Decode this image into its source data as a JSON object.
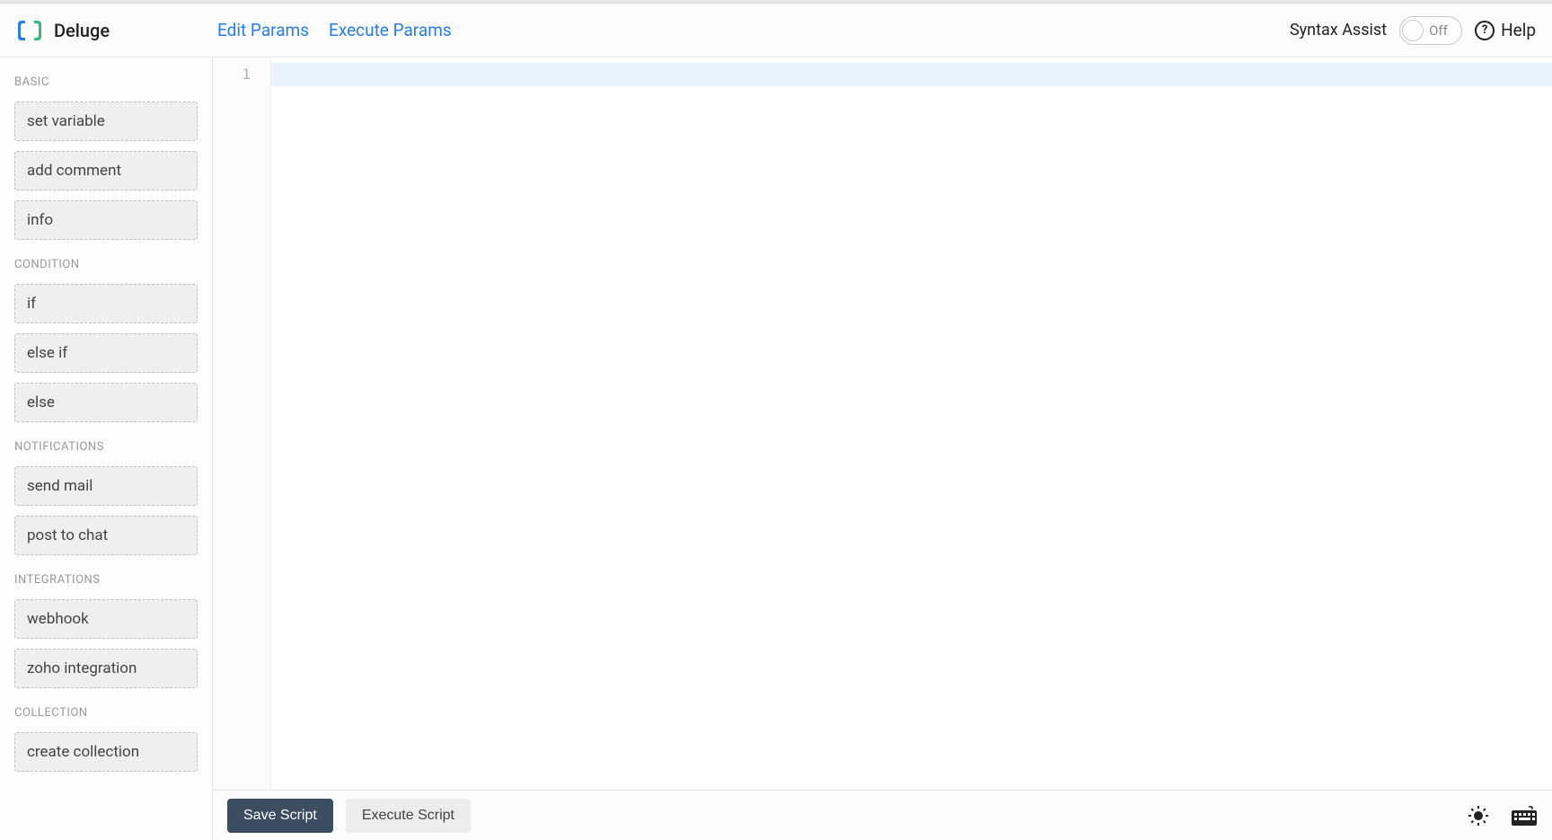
{
  "header": {
    "title": "Deluge",
    "links": {
      "edit_params": "Edit Params",
      "execute_params": "Execute Params"
    },
    "syntax_assist_label": "Syntax Assist",
    "toggle_state": "Off",
    "help_label": "Help"
  },
  "sidebar": {
    "categories": [
      {
        "label": "BASIC",
        "items": [
          "set variable",
          "add comment",
          "info"
        ]
      },
      {
        "label": "CONDITION",
        "items": [
          "if",
          "else if",
          "else"
        ]
      },
      {
        "label": "NOTIFICATIONS",
        "items": [
          "send mail",
          "post to chat"
        ]
      },
      {
        "label": "INTEGRATIONS",
        "items": [
          "webhook",
          "zoho integration"
        ]
      },
      {
        "label": "COLLECTION",
        "items": [
          "create collection"
        ]
      }
    ]
  },
  "editor": {
    "line_numbers": [
      "1"
    ]
  },
  "footer": {
    "save_label": "Save Script",
    "execute_label": "Execute Script"
  }
}
